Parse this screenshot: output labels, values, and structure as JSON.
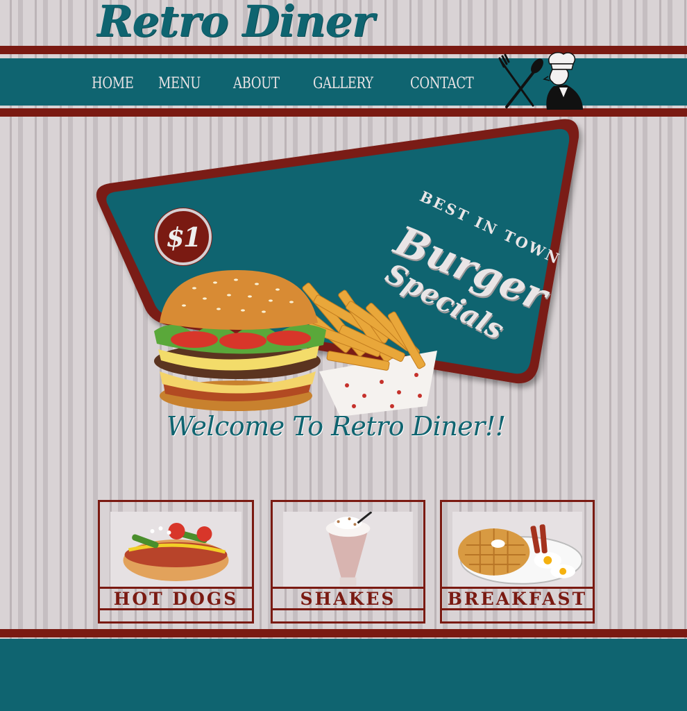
{
  "site": {
    "logo": "Retro Diner"
  },
  "nav": {
    "items": [
      {
        "label": "HOME"
      },
      {
        "label": "MENU"
      },
      {
        "label": "ABOUT"
      },
      {
        "label": "GALLERY"
      },
      {
        "label": "CONTACT"
      }
    ]
  },
  "hero": {
    "price": "$1",
    "tagline": "BEST IN TOWN",
    "headline_1": "Burger",
    "headline_2": "Specials",
    "welcome": "Welcome To Retro Diner!!"
  },
  "cards": [
    {
      "label": "HOT DOGS",
      "icon": "hot-dog-image"
    },
    {
      "label": "SHAKES",
      "icon": "milkshake-image"
    },
    {
      "label": "BREAKFAST",
      "icon": "waffles-eggs-image"
    }
  ],
  "colors": {
    "teal": "#0f6470",
    "maroon": "#7a1a12",
    "background": "#d9d3d5"
  }
}
